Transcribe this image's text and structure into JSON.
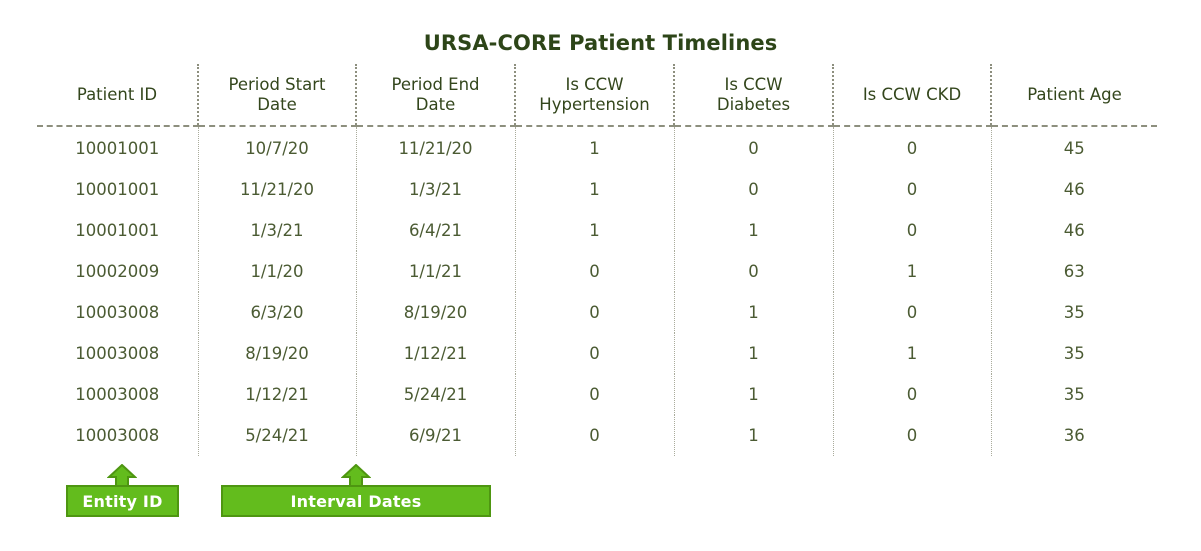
{
  "title": "URSA-CORE Patient Timelines",
  "theme": {
    "title_color": "#2d4518",
    "header_text_color": "#33461c",
    "body_text_color": "#4b5b33",
    "grid_color": "#8d8f7e",
    "callout_fill": "#63bc1d",
    "callout_border": "#4e9611",
    "callout_text": "#ffffff",
    "background": "#ffffff"
  },
  "table": {
    "columns": [
      {
        "key": "patient_id",
        "line1": "Patient ID",
        "line2": ""
      },
      {
        "key": "period_start",
        "line1": "Period Start",
        "line2": "Date"
      },
      {
        "key": "period_end",
        "line1": "Period End",
        "line2": "Date"
      },
      {
        "key": "ccw_hypertension",
        "line1": "Is CCW",
        "line2": "Hypertension"
      },
      {
        "key": "ccw_diabetes",
        "line1": "Is CCW",
        "line2": "Diabetes"
      },
      {
        "key": "ccw_ckd",
        "line1": "Is CCW CKD",
        "line2": ""
      },
      {
        "key": "patient_age",
        "line1": "Patient Age",
        "line2": ""
      }
    ],
    "rows": [
      [
        "10001001",
        "10/7/20",
        "11/21/20",
        "1",
        "0",
        "0",
        "45"
      ],
      [
        "10001001",
        "11/21/20",
        "1/3/21",
        "1",
        "0",
        "0",
        "46"
      ],
      [
        "10001001",
        "1/3/21",
        "6/4/21",
        "1",
        "1",
        "0",
        "46"
      ],
      [
        "10002009",
        "1/1/20",
        "1/1/21",
        "0",
        "0",
        "1",
        "63"
      ],
      [
        "10003008",
        "6/3/20",
        "8/19/20",
        "0",
        "1",
        "0",
        "35"
      ],
      [
        "10003008",
        "8/19/20",
        "1/12/21",
        "0",
        "1",
        "1",
        "35"
      ],
      [
        "10003008",
        "1/12/21",
        "5/24/21",
        "0",
        "1",
        "0",
        "35"
      ],
      [
        "10003008",
        "5/24/21",
        "6/9/21",
        "0",
        "1",
        "0",
        "36"
      ]
    ]
  },
  "callouts": [
    {
      "key": "entity_id",
      "label": "Entity ID"
    },
    {
      "key": "interval_dates",
      "label": "Interval Dates"
    }
  ]
}
